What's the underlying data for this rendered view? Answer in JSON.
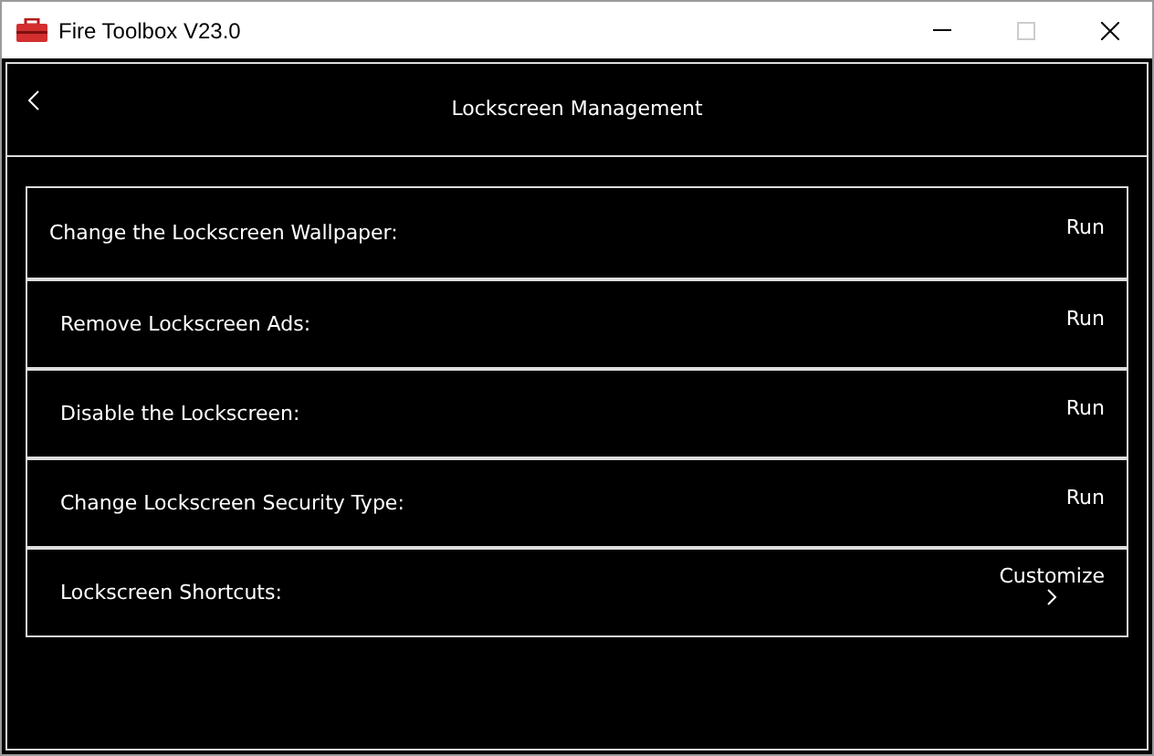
{
  "window": {
    "title": "Fire Toolbox V23.0",
    "maximize_disabled": true
  },
  "header": {
    "title": "Lockscreen Management"
  },
  "options": [
    {
      "label": "Change the Lockscreen Wallpaper:",
      "kind": "run",
      "action": "Run"
    },
    {
      "label": "Remove Lockscreen Ads:",
      "kind": "run",
      "action": "Run"
    },
    {
      "label": "Disable the Lockscreen:",
      "kind": "run",
      "action": "Run"
    },
    {
      "label": "Change Lockscreen Security Type:",
      "kind": "run",
      "action": "Run"
    },
    {
      "label": "Lockscreen Shortcuts:",
      "kind": "customize",
      "action": "Customize"
    }
  ]
}
